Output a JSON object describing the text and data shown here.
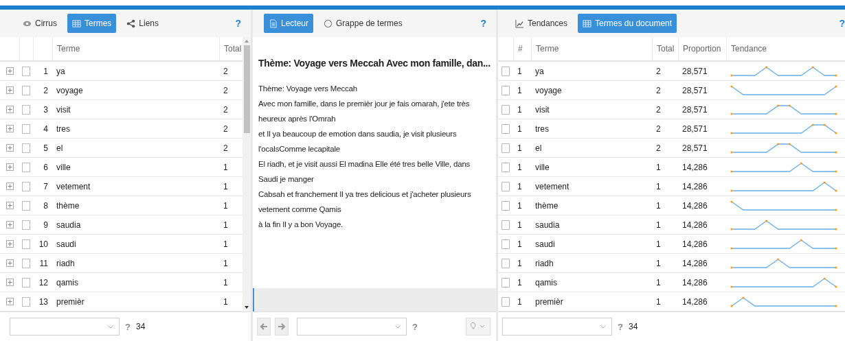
{
  "left": {
    "tabs": [
      {
        "label": "Cirrus",
        "selected": false
      },
      {
        "label": "Termes",
        "selected": true
      },
      {
        "label": "Liens",
        "selected": false
      }
    ],
    "help": "?",
    "columns": [
      "Terme",
      "Total"
    ],
    "rows": [
      {
        "num": "1",
        "term": "ya",
        "total": "2",
        "checked": false,
        "expanded": false
      },
      {
        "num": "2",
        "term": "voyage",
        "total": "2",
        "checked": false,
        "expanded": false
      },
      {
        "num": "3",
        "term": "visit",
        "total": "2",
        "checked": false,
        "expanded": false
      },
      {
        "num": "4",
        "term": "tres",
        "total": "2",
        "checked": false,
        "expanded": false
      },
      {
        "num": "5",
        "term": "el",
        "total": "2",
        "checked": false,
        "expanded": false
      },
      {
        "num": "6",
        "term": "ville",
        "total": "1",
        "checked": false,
        "expanded": false
      },
      {
        "num": "7",
        "term": "vetement",
        "total": "1",
        "checked": false,
        "expanded": false
      },
      {
        "num": "8",
        "term": "thème",
        "total": "1",
        "checked": false,
        "expanded": false
      },
      {
        "num": "9",
        "term": "saudia",
        "total": "1",
        "checked": false,
        "expanded": false
      },
      {
        "num": "10",
        "term": "saudi",
        "total": "1",
        "checked": false,
        "expanded": false
      },
      {
        "num": "11",
        "term": "riadh",
        "total": "1",
        "checked": false,
        "expanded": false
      },
      {
        "num": "12",
        "term": "qamis",
        "total": "1",
        "checked": false,
        "expanded": false
      },
      {
        "num": "13",
        "term": "premièr",
        "total": "1",
        "checked": false,
        "expanded": false
      }
    ],
    "footer": {
      "help": "?",
      "count": "34"
    }
  },
  "middle": {
    "tabs": [
      {
        "label": "Lecteur",
        "selected": true
      },
      {
        "label": "Grappe de termes",
        "selected": false
      }
    ],
    "help": "?",
    "title": "Thème: Voyage vers Meccah Avec mon famille, dan...",
    "lines": [
      "Thème: Voyage vers Meccah",
      "Avec mon famille, dans le premièr jour je fais omarah, j'ete très heureux après l'Omrah",
      "et Il ya beaucoup de emotion dans saudia, je visit plusieurs l'ocalsComme lecapitale",
      "El riadh, et je visit aussi El madina Elle été tres belle Ville, dans Saudi je manger",
      "Cabsah et franchement Il ya tres delicious et j'acheter plusieurs vetement comme Qamis",
      "à la fin Il y a bon Voyage."
    ],
    "footer": {
      "help": "?"
    }
  },
  "right": {
    "tabs": [
      {
        "label": "Tendances",
        "selected": false
      },
      {
        "label": "Termes du document",
        "selected": true
      }
    ],
    "help": "?",
    "columns": [
      "#",
      "Terme",
      "Total",
      "Proportion",
      "Tendance"
    ],
    "rows": [
      {
        "num": "1",
        "term": "ya",
        "total": "2",
        "proportion": "28,571",
        "checked": false
      },
      {
        "num": "1",
        "term": "voyage",
        "total": "2",
        "proportion": "28,571",
        "checked": false
      },
      {
        "num": "1",
        "term": "visit",
        "total": "2",
        "proportion": "28,571",
        "checked": false
      },
      {
        "num": "1",
        "term": "tres",
        "total": "2",
        "proportion": "28,571",
        "checked": false
      },
      {
        "num": "1",
        "term": "el",
        "total": "2",
        "proportion": "28,571",
        "checked": false
      },
      {
        "num": "1",
        "term": "ville",
        "total": "1",
        "proportion": "14,286",
        "checked": false
      },
      {
        "num": "1",
        "term": "vetement",
        "total": "1",
        "proportion": "14,286",
        "checked": false
      },
      {
        "num": "1",
        "term": "thème",
        "total": "1",
        "proportion": "14,286",
        "checked": false
      },
      {
        "num": "1",
        "term": "saudia",
        "total": "1",
        "proportion": "14,286",
        "checked": false
      },
      {
        "num": "1",
        "term": "saudi",
        "total": "1",
        "proportion": "14,286",
        "checked": false
      },
      {
        "num": "1",
        "term": "riadh",
        "total": "1",
        "proportion": "14,286",
        "checked": false
      },
      {
        "num": "1",
        "term": "qamis",
        "total": "1",
        "proportion": "14,286",
        "checked": false
      },
      {
        "num": "1",
        "term": "premièr",
        "total": "1",
        "proportion": "14,286",
        "checked": false
      }
    ],
    "footer": {
      "help": "?",
      "count": "34"
    }
  }
}
